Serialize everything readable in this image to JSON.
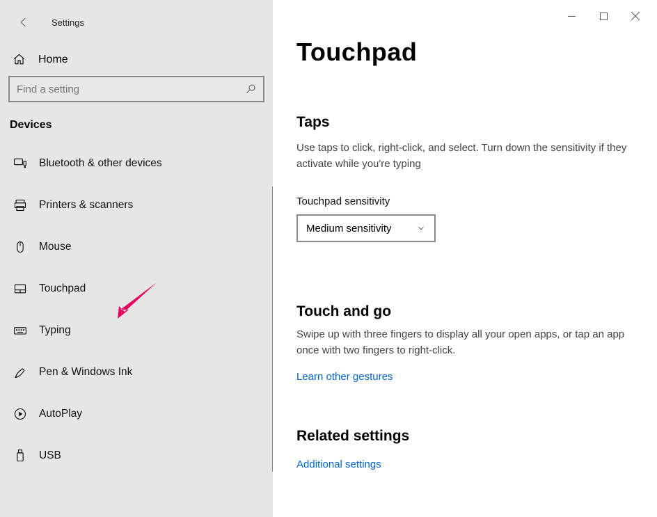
{
  "window": {
    "title": "Settings"
  },
  "sidebar": {
    "home_label": "Home",
    "search_placeholder": "Find a setting",
    "section": "Devices",
    "items": [
      {
        "label": "Bluetooth & other devices"
      },
      {
        "label": "Printers & scanners"
      },
      {
        "label": "Mouse"
      },
      {
        "label": "Touchpad"
      },
      {
        "label": "Typing"
      },
      {
        "label": "Pen & Windows Ink"
      },
      {
        "label": "AutoPlay"
      },
      {
        "label": "USB"
      }
    ]
  },
  "main": {
    "title": "Touchpad",
    "taps": {
      "heading": "Taps",
      "description": "Use taps to click, right-click, and select. Turn down the sensitivity if they activate while you're typing",
      "sensitivity_label": "Touchpad sensitivity",
      "sensitivity_value": "Medium sensitivity"
    },
    "touch_and_go": {
      "heading": "Touch and go",
      "description": "Swipe up with three fingers to display all your open apps, or tap an app once with two fingers to right-click.",
      "link": "Learn other gestures"
    },
    "related": {
      "heading": "Related settings",
      "link": "Additional settings"
    }
  }
}
